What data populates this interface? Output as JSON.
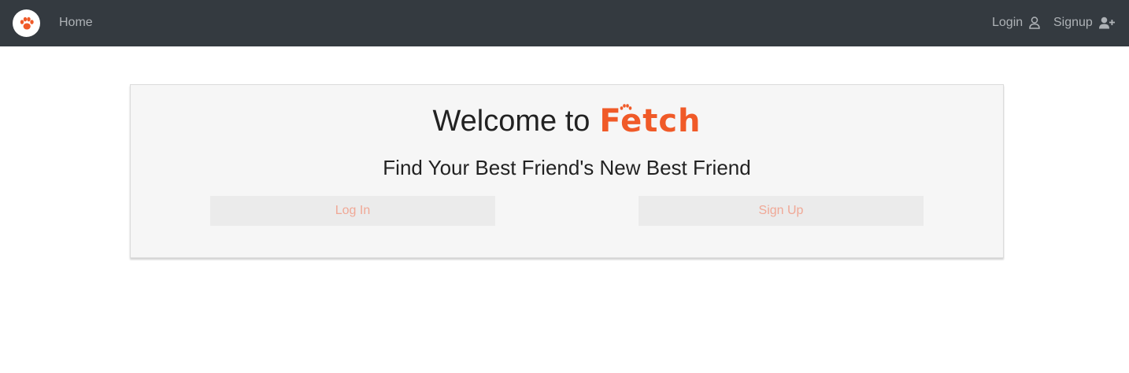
{
  "nav": {
    "brand_icon": "paw-icon",
    "home_label": "Home",
    "login_label": "Login",
    "login_icon": "user-icon",
    "signup_label": "Signup",
    "signup_icon": "user-plus-icon"
  },
  "hero": {
    "welcome_text": "Welcome to",
    "brand_name": "Fetch",
    "tagline": "Find Your Best Friend's New Best Friend",
    "login_button": "Log In",
    "signup_button": "Sign Up"
  },
  "colors": {
    "navbar_bg": "#343a40",
    "brand_orange": "#f05a28",
    "card_bg": "#f6f6f6",
    "button_text": "#f0a896"
  }
}
